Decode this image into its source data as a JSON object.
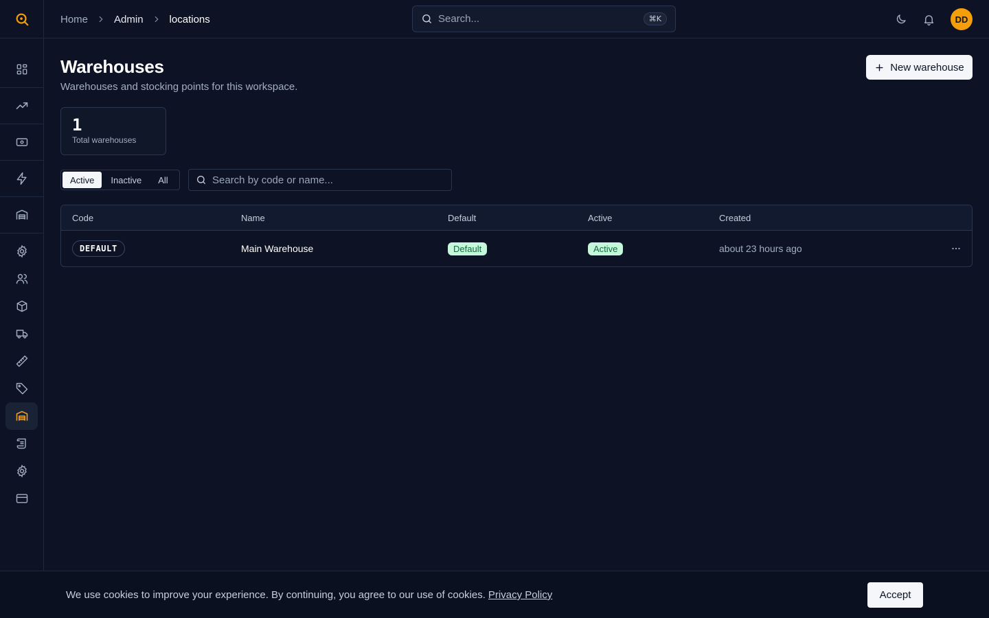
{
  "breadcrumb": {
    "home": "Home",
    "admin": "Admin",
    "current": "locations"
  },
  "search": {
    "placeholder": "Search...",
    "shortcut": "⌘K"
  },
  "user": {
    "initials": "DD"
  },
  "page": {
    "title": "Warehouses",
    "subtitle": "Warehouses and stocking points for this workspace.",
    "new_button": "New warehouse"
  },
  "stats": {
    "total_value": "1",
    "total_label": "Total warehouses"
  },
  "filters": {
    "options": [
      "Active",
      "Inactive",
      "All"
    ],
    "selected": "Active",
    "search_placeholder": "Search by code or name..."
  },
  "table": {
    "columns": [
      "Code",
      "Name",
      "Default",
      "Active",
      "Created"
    ],
    "rows": [
      {
        "code": "DEFAULT",
        "name": "Main Warehouse",
        "default": "Default",
        "active": "Active",
        "created": "about 23 hours ago"
      }
    ]
  },
  "cookie": {
    "text": "We use cookies to improve your experience. By continuing, you agree to our use of cookies.",
    "link": "Privacy Policy",
    "accept": "Accept"
  },
  "colors": {
    "accent": "#f59e0b",
    "background": "#0d1325",
    "success_bg": "#c6f6dc",
    "success_text": "#0f6b3a"
  }
}
